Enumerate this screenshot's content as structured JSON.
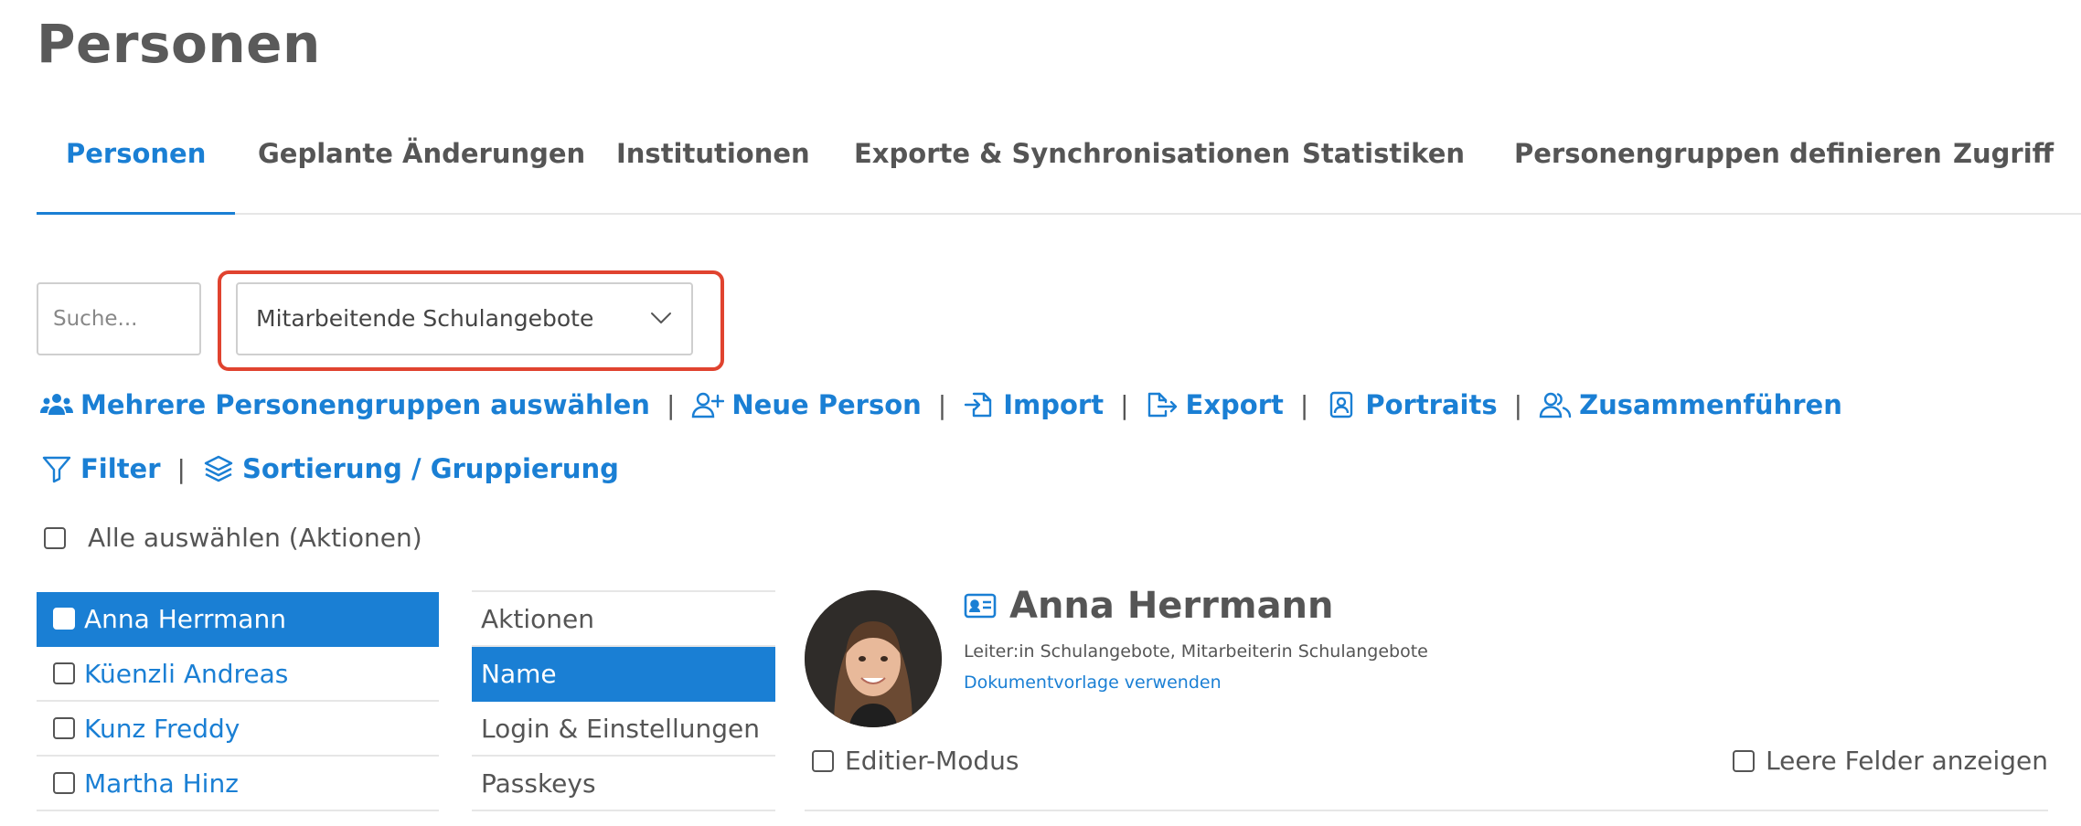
{
  "page": {
    "title": "Personen"
  },
  "tabs": [
    {
      "label": "Personen",
      "active": true
    },
    {
      "label": "Geplante Änderungen"
    },
    {
      "label": "Institutionen"
    },
    {
      "label": "Exporte & Synchronisationen"
    },
    {
      "label": "Statistiken"
    },
    {
      "label": "Personengruppen definieren"
    },
    {
      "label": "Zugriff"
    }
  ],
  "search": {
    "placeholder": "Suche...",
    "value": ""
  },
  "group_select": {
    "selected": "Mitarbeitende Schulangebote"
  },
  "actions": {
    "multi_groups": "Mehrere Personengruppen auswählen",
    "new_person": "Neue Person",
    "import": "Import",
    "export": "Export",
    "portraits": "Portraits",
    "merge": "Zusammenführen",
    "filter": "Filter",
    "sorting": "Sortierung / Gruppierung",
    "separator": "|"
  },
  "select_all": {
    "label": "Alle auswählen (Aktionen)"
  },
  "persons": [
    {
      "name": "Anna Herrmann",
      "active": true
    },
    {
      "name": "Küenzli Andreas"
    },
    {
      "name": "Kunz Freddy"
    },
    {
      "name": "Martha Hinz"
    }
  ],
  "sections": [
    {
      "label": "Aktionen"
    },
    {
      "label": "Name",
      "active": true
    },
    {
      "label": "Login & Einstellungen"
    },
    {
      "label": "Passkeys"
    }
  ],
  "detail": {
    "name": "Anna Herrmann",
    "roles": "Leiter:in Schulangebote, Mitarbeiterin Schulangebote",
    "template_link": "Dokumentvorlage verwenden",
    "edit_mode": "Editier-Modus",
    "show_empty": "Leere Felder anzeigen"
  },
  "colors": {
    "accent": "#1a7fd4",
    "highlight": "#e0432f",
    "text": "#555555"
  }
}
